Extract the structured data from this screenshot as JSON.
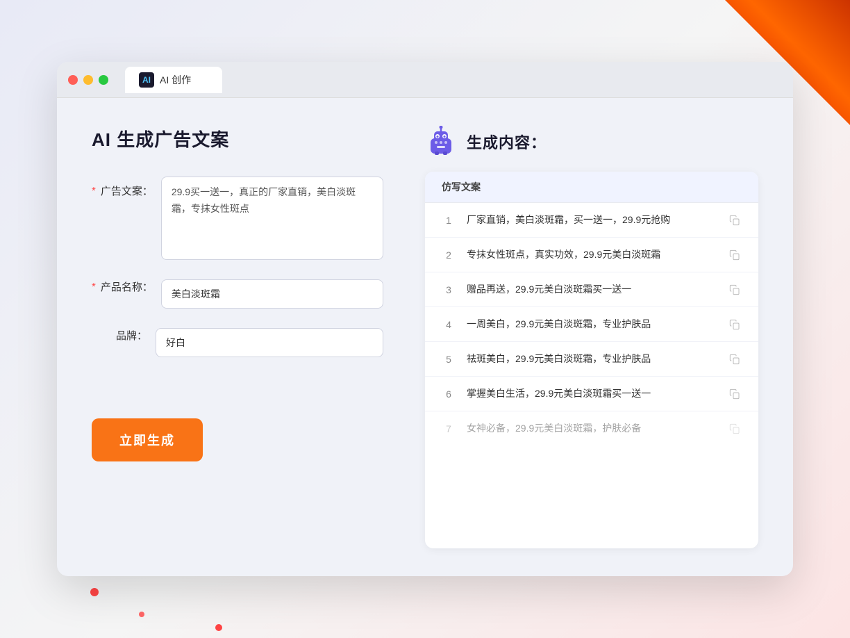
{
  "window": {
    "tab_icon_text": "AI",
    "tab_title": "AI 创作"
  },
  "left_panel": {
    "page_title": "AI 生成广告文案",
    "form": {
      "ad_copy_label": "广告文案：",
      "ad_copy_required": "*",
      "ad_copy_value": "29.9买一送一，真正的厂家直销，美白淡斑霜，专抹女性斑点",
      "product_name_label": "产品名称：",
      "product_name_required": "*",
      "product_name_value": "美白淡斑霜",
      "brand_label": "品牌：",
      "brand_value": "好白",
      "generate_button": "立即生成"
    }
  },
  "right_panel": {
    "title": "生成内容：",
    "table_header": "仿写文案",
    "items": [
      {
        "num": "1",
        "text": "厂家直销，美白淡斑霜，买一送一，29.9元抢购",
        "dimmed": false
      },
      {
        "num": "2",
        "text": "专抹女性斑点，真实功效，29.9元美白淡斑霜",
        "dimmed": false
      },
      {
        "num": "3",
        "text": "赠品再送，29.9元美白淡斑霜买一送一",
        "dimmed": false
      },
      {
        "num": "4",
        "text": "一周美白，29.9元美白淡斑霜，专业护肤品",
        "dimmed": false
      },
      {
        "num": "5",
        "text": "祛斑美白，29.9元美白淡斑霜，专业护肤品",
        "dimmed": false
      },
      {
        "num": "6",
        "text": "掌握美白生活，29.9元美白淡斑霜买一送一",
        "dimmed": false
      },
      {
        "num": "7",
        "text": "女神必备，29.9元美白淡斑霜，护肤必备",
        "dimmed": true
      }
    ]
  }
}
